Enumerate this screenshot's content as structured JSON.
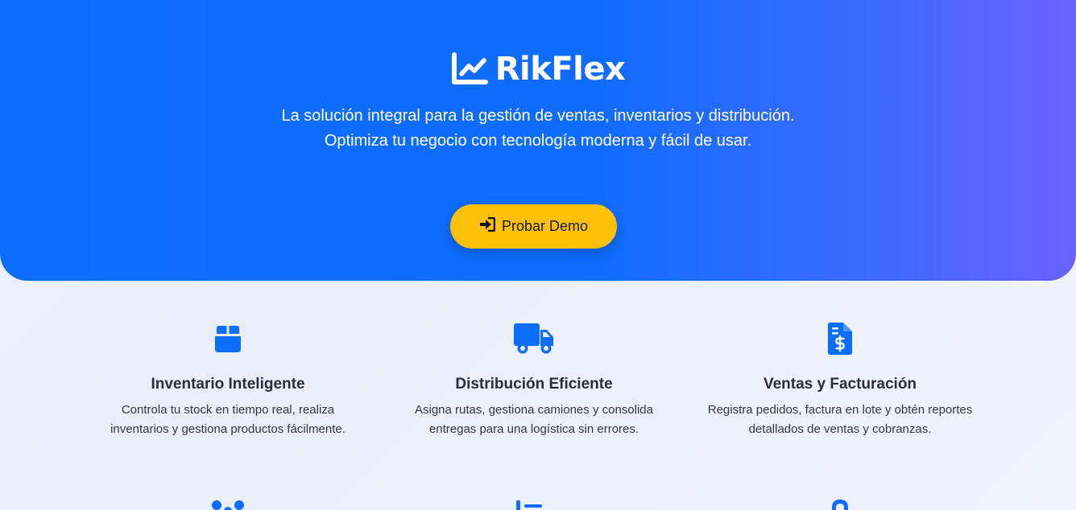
{
  "hero": {
    "brand_name": "RikFlex",
    "brand_icon": "chart-line-icon",
    "tagline_line1": "La solución integral para la gestión de ventas, inventarios y distribución.",
    "tagline_line2": "Optimiza tu negocio con tecnología moderna y fácil de usar.",
    "demo_button_label": "Probar Demo",
    "demo_button_icon": "sign-in-icon",
    "gradient_start": "#0d6efd",
    "gradient_end": "#6b61ff",
    "button_color": "#ffc107"
  },
  "features": [
    {
      "icon": "box-icon",
      "title": "Inventario Inteligente",
      "desc_line1": "Controla tu stock en tiempo real, realiza",
      "desc_line2": "inventarios y gestiona productos fácilmente."
    },
    {
      "icon": "truck-icon",
      "title": "Distribución Eficiente",
      "desc_line1": "Asigna rutas, gestiona camiones y consolida",
      "desc_line2": "entregas para una logística sin errores."
    },
    {
      "icon": "invoice-dollar-icon",
      "title": "Ventas y Facturación",
      "desc_line1": "Registra pedidos, factura en lote y obtén reportes",
      "desc_line2": "detallados de ventas y cobranzas."
    }
  ],
  "accent_color": "#0d6efd"
}
